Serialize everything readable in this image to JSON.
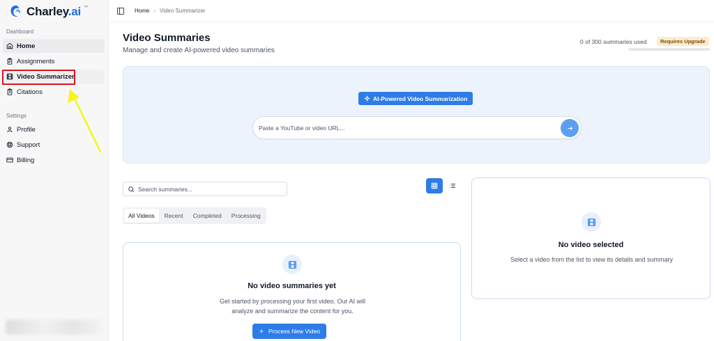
{
  "app": {
    "name_main": "Charley",
    "name_ai": ".ai"
  },
  "sidebar": {
    "sections": [
      {
        "label": "Dashboard"
      },
      {
        "label": "Settings"
      }
    ],
    "items": [
      {
        "label": "Home",
        "icon": "home-icon"
      },
      {
        "label": "Assignments",
        "icon": "clipboard-icon"
      },
      {
        "label": "Video Summarizer",
        "icon": "film-icon"
      },
      {
        "label": "Citations",
        "icon": "clipboard-list-icon"
      },
      {
        "label": "Profile",
        "icon": "user-icon"
      },
      {
        "label": "Support",
        "icon": "lifebuoy-icon"
      },
      {
        "label": "Billing",
        "icon": "credit-card-icon"
      }
    ]
  },
  "breadcrumb": {
    "home": "Home",
    "current": "Video Summarizer"
  },
  "header": {
    "title": "Video Summaries",
    "subtitle": "Manage and create AI-powered video summaries",
    "usage_text": "0 of 300 summaries used",
    "upgrade_badge": "Requires Upgrade",
    "usage_fraction": 0
  },
  "hero": {
    "badge": "AI-Powered Video Summarization",
    "url_placeholder": "Paste a YouTube or video URL..."
  },
  "search": {
    "placeholder": "Search summaries..."
  },
  "tabs": [
    "All Videos",
    "Recent",
    "Completed",
    "Processing"
  ],
  "active_tab": "All Videos",
  "empty_list": {
    "title": "No video summaries yet",
    "desc_line1": "Get started by processing your first video. Our AI will",
    "desc_line2": "analyze and summarize the content for you.",
    "button": "Process New Video"
  },
  "detail": {
    "title": "No video selected",
    "desc": "Select a video from the list to view its details and summary"
  },
  "colors": {
    "accent": "#2e7ce6",
    "annotation_box": "#d9141b",
    "annotation_arrow": "#f5f51a"
  }
}
